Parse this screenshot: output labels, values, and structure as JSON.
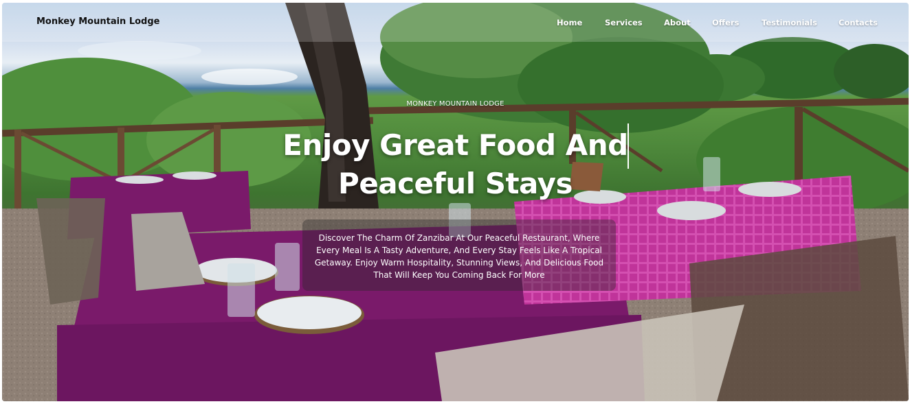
{
  "site": {
    "brand": "Monkey Mountain Lodge"
  },
  "nav": {
    "items": [
      "Home",
      "Services",
      "About",
      "Offers",
      "Testimonials",
      "Contacts"
    ]
  },
  "hero": {
    "kicker": "MONKEY MOUNTAIN LODGE",
    "headline_line1": "Enjoy Great Food And",
    "headline_line2": "Peaceful Stays",
    "description": "Discover The Charm Of Zanzibar At Our Peaceful Restaurant, Where Every Meal Is A Tasty Adventure, And Every Stay Feels Like A Tropical Getaway. Enjoy Warm Hospitality, Stunning Views, And Delicious Food That Will Keep You Coming Back For More"
  },
  "colors": {
    "nav_text": "#ffffff",
    "brand_text": "#111111",
    "tablecloth_purple": "#7a1a6a",
    "tablecloth_pink": "#c0349a",
    "railing_wood": "#5a3d2b"
  }
}
